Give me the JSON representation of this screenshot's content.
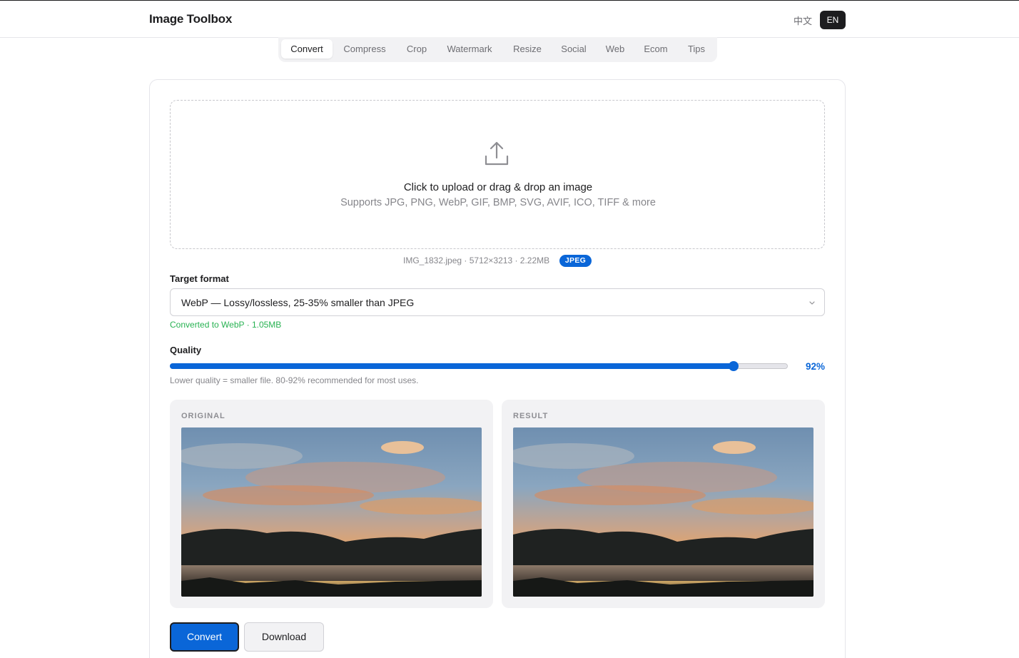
{
  "header": {
    "brand": "Image Toolbox",
    "lang_zh": "中文",
    "lang_en": "EN"
  },
  "tabs": [
    {
      "label": "Convert",
      "active": true
    },
    {
      "label": "Compress"
    },
    {
      "label": "Crop"
    },
    {
      "label": "Watermark"
    },
    {
      "label": "Resize"
    },
    {
      "label": "Social"
    },
    {
      "label": "Web"
    },
    {
      "label": "Ecom"
    },
    {
      "label": "Tips"
    }
  ],
  "upload": {
    "icon": "upload-icon",
    "title": "Click to upload or drag & drop an image",
    "subtitle": "Supports JPG, PNG, WebP, GIF, BMP, SVG, AVIF, ICO, TIFF & more"
  },
  "file": {
    "info": "IMG_1832.jpeg · 5712×3213 · 2.22MB",
    "badge": "JPEG"
  },
  "format": {
    "label": "Target format",
    "selected": "WebP — Lossy/lossless, 25-35% smaller than JPEG",
    "status": "Converted to WebP · 1.05MB"
  },
  "quality": {
    "label": "Quality",
    "value": 92,
    "display": "92%",
    "slider_fraction": 0.912,
    "hint": "Lower quality = smaller file. 80-92% recommended for most uses."
  },
  "preview": {
    "original_label": "ORIGINAL",
    "result_label": "RESULT"
  },
  "actions": {
    "convert": "Convert",
    "download": "Download"
  },
  "colors": {
    "accent": "#0a66d8",
    "success": "#28b252",
    "dark": "#1d1d1f",
    "panel": "#f2f2f4"
  }
}
